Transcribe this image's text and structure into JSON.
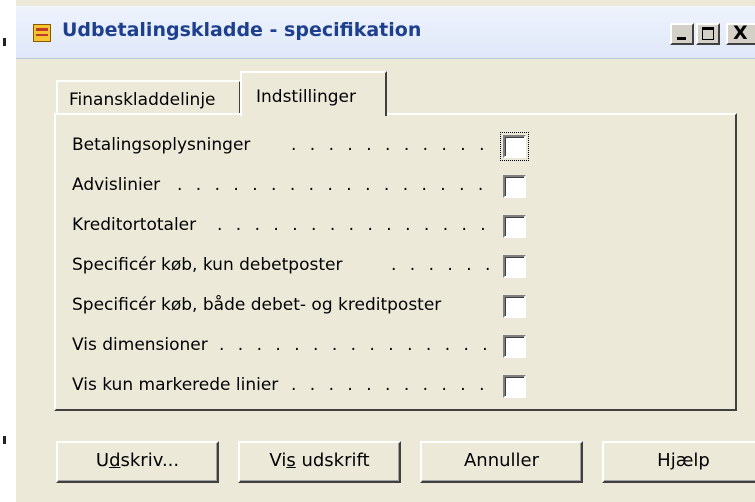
{
  "window": {
    "title": "Udbetalingskladde - specifikation",
    "caption_close": "X"
  },
  "tabs": [
    {
      "label": "Finanskladdelinje",
      "active": false
    },
    {
      "label": "Indstillinger",
      "active": true
    }
  ],
  "options": [
    {
      "label": "Betalingsoplysninger",
      "dots": ". . . . . . . . . . .",
      "checked": false,
      "focused": true
    },
    {
      "label": "Advislinier",
      "dots": ". . . . . . . . . . . . . . . . .",
      "checked": false
    },
    {
      "label": "Kreditortotaler",
      "dots": ". . . . . . . . . . . . . . .",
      "checked": false
    },
    {
      "label": "Specificér køb, kun debetposter",
      "dots": ". . . . . .",
      "checked": false
    },
    {
      "label": "Specificér køb, både debet- og kreditposter",
      "dots": "",
      "checked": false
    },
    {
      "label": "Vis dimensioner",
      "dots": ". . . . . . . . . . . . . . .",
      "checked": false
    },
    {
      "label": "Vis kun markerede linier",
      "dots": ". . . . . . . . . . .",
      "checked": false
    }
  ],
  "buttons": {
    "print": {
      "pre": "U",
      "key": "d",
      "post": "skriv..."
    },
    "preview": {
      "pre": "Vi",
      "key": "s",
      "post": " udskrift"
    },
    "cancel": "Annuller",
    "help": "Hjælp"
  }
}
